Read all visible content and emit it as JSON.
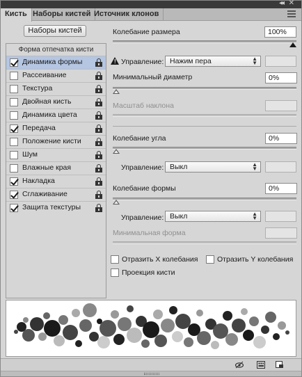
{
  "tabs": [
    "Кисть",
    "Наборы кистей",
    "Источник клонов"
  ],
  "brush_presets_button": "Наборы кистей",
  "list": {
    "header": "Форма отпечатка кисти",
    "items": [
      {
        "label": "Динамика формы",
        "checked": true,
        "selected": true
      },
      {
        "label": "Рассеивание",
        "checked": false
      },
      {
        "label": "Текстура",
        "checked": false
      },
      {
        "label": "Двойная кисть",
        "checked": false
      },
      {
        "label": "Динамика цвета",
        "checked": false
      },
      {
        "label": "Передача",
        "checked": true
      },
      {
        "label": "Положение кисти",
        "checked": false
      },
      {
        "label": "Шум",
        "checked": false
      },
      {
        "label": "Влажные края",
        "checked": false
      },
      {
        "label": "Накладка",
        "checked": true
      },
      {
        "label": "Сглаживание",
        "checked": true
      },
      {
        "label": "Защита текстуры",
        "checked": true
      }
    ]
  },
  "controls": {
    "size_jitter_label": "Колебание размера",
    "size_jitter_value": "100%",
    "size_jitter_level": 1.0,
    "control_label": "Управление:",
    "size_control_value": "Нажим пера",
    "min_diameter_label": "Минимальный диаметр",
    "min_diameter_value": "0%",
    "min_diameter_level": 0.0,
    "tilt_scale_label": "Масштаб наклона",
    "angle_jitter_label": "Колебание угла",
    "angle_jitter_value": "0%",
    "angle_jitter_level": 0.0,
    "angle_control_value": "Выкл",
    "roundness_jitter_label": "Колебание формы",
    "roundness_jitter_value": "0%",
    "roundness_jitter_level": 0.0,
    "roundness_control_value": "Выкл",
    "min_roundness_label": "Минимальная форма",
    "flip_x_label": "Отразить X колебания",
    "flip_y_label": "Отразить Y колебания",
    "brush_projection_label": "Проекция кисти"
  },
  "colors": {
    "panel_bg": "#d6d6d6",
    "selected_row": "#b4c6e2"
  }
}
